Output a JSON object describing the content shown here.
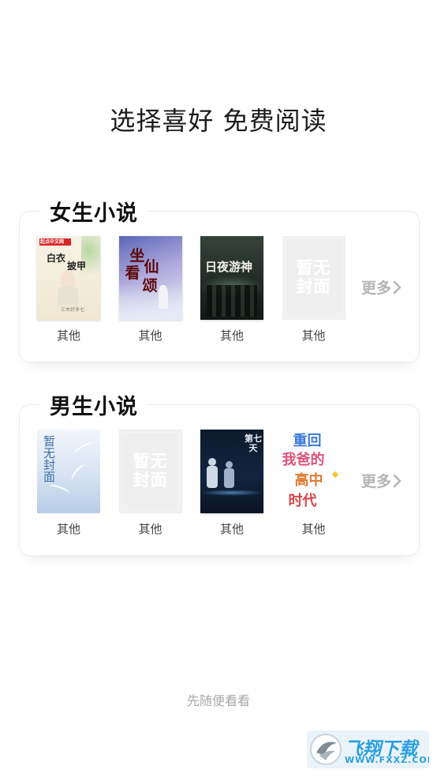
{
  "header": {
    "title": "选择喜好 免费阅读"
  },
  "sections": [
    {
      "title": "女生小说",
      "more_label": "更多",
      "books": [
        {
          "category": "其他",
          "cover_text": [
            "白衣",
            "披甲"
          ],
          "publisher": "起点中文网",
          "author": "三木好多七"
        },
        {
          "category": "其他",
          "cover_text": [
            "坐",
            "看",
            "仙",
            "颂"
          ]
        },
        {
          "category": "其他",
          "cover_text": [
            "日夜游神"
          ]
        },
        {
          "category": "其他",
          "cover_text": [
            "暂无",
            "封面"
          ]
        }
      ]
    },
    {
      "title": "男生小说",
      "more_label": "更多",
      "books": [
        {
          "category": "其他",
          "cover_text": [
            "暂",
            "无",
            "封",
            "面"
          ]
        },
        {
          "category": "其他",
          "cover_text": [
            "暂无",
            "封面"
          ]
        },
        {
          "category": "其他",
          "cover_text": [
            "第七",
            "天"
          ]
        },
        {
          "category": "其他",
          "cover_text": [
            "重回",
            "我爸的",
            "高中",
            "时代"
          ]
        }
      ]
    }
  ],
  "footer": {
    "skip_label": "先随便看看"
  },
  "watermark": {
    "brand": "飞翔下载",
    "url": "WWW.FXXZ.COM"
  },
  "colors": {
    "accent": "#2a9fe0",
    "muted": "#b5b5b5",
    "border": "#ececec"
  }
}
